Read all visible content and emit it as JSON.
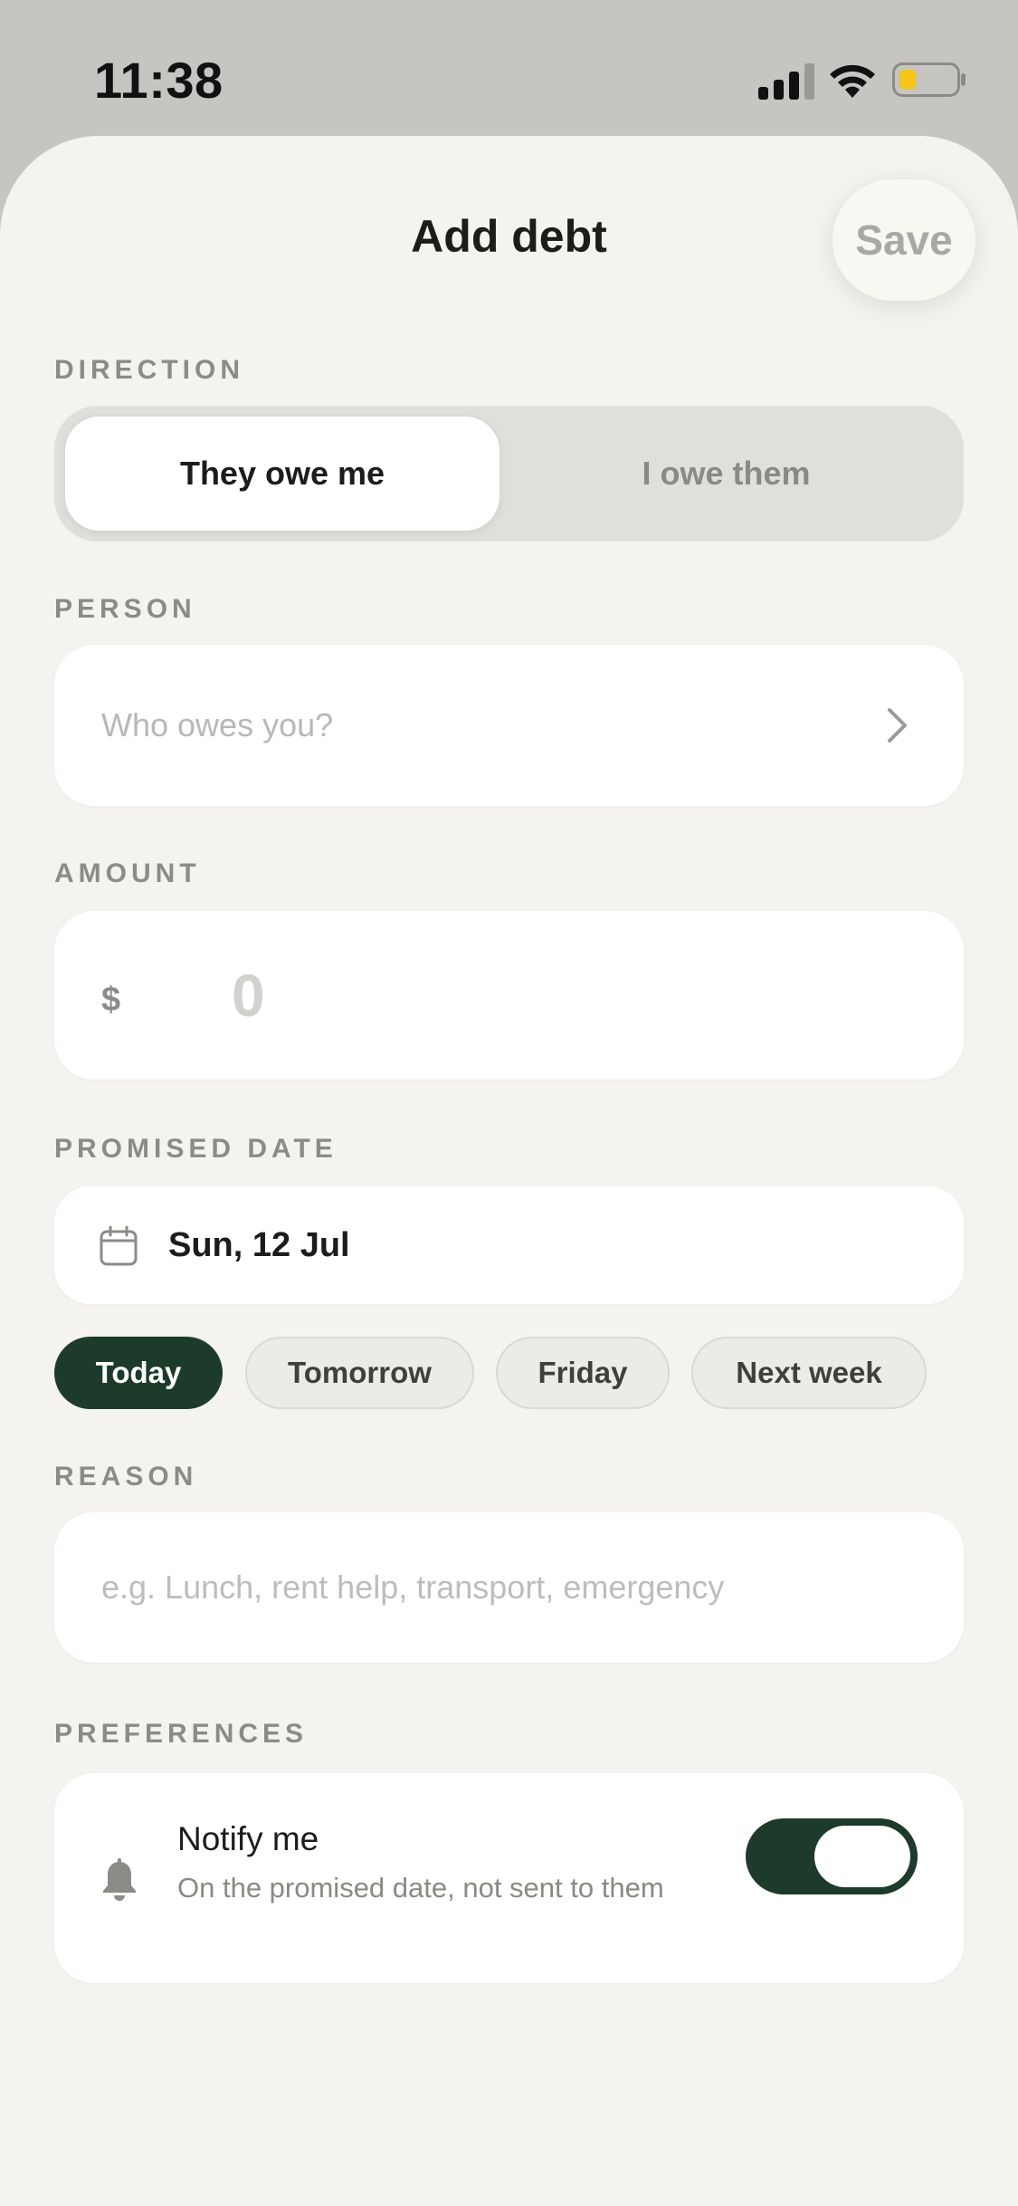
{
  "status_bar": {
    "time": "11:38",
    "battery_color": "#f5c518"
  },
  "header": {
    "title": "Add debt",
    "save_label": "Save"
  },
  "direction": {
    "label": "DIRECTION",
    "options": [
      "They owe me",
      "I owe them"
    ],
    "selected": "They owe me"
  },
  "person": {
    "label": "PERSON",
    "placeholder": "Who owes you?"
  },
  "amount": {
    "label": "AMOUNT",
    "currency": "$",
    "value": "0"
  },
  "promised_date": {
    "label": "PROMISED DATE",
    "value": "Sun, 12 Jul",
    "quick_options": [
      "Today",
      "Tomorrow",
      "Friday",
      "Next week"
    ],
    "selected": "Today"
  },
  "reason": {
    "label": "REASON",
    "placeholder": "e.g. Lunch, rent help, transport, emergency"
  },
  "preferences": {
    "label": "PREFERENCES",
    "notify_title": "Notify me",
    "notify_subtitle": "On the promised date, not sent to them",
    "notify_enabled": true
  },
  "colors": {
    "accent": "#1c3b2a",
    "background": "#f4f3f0",
    "card": "#ffffff"
  }
}
